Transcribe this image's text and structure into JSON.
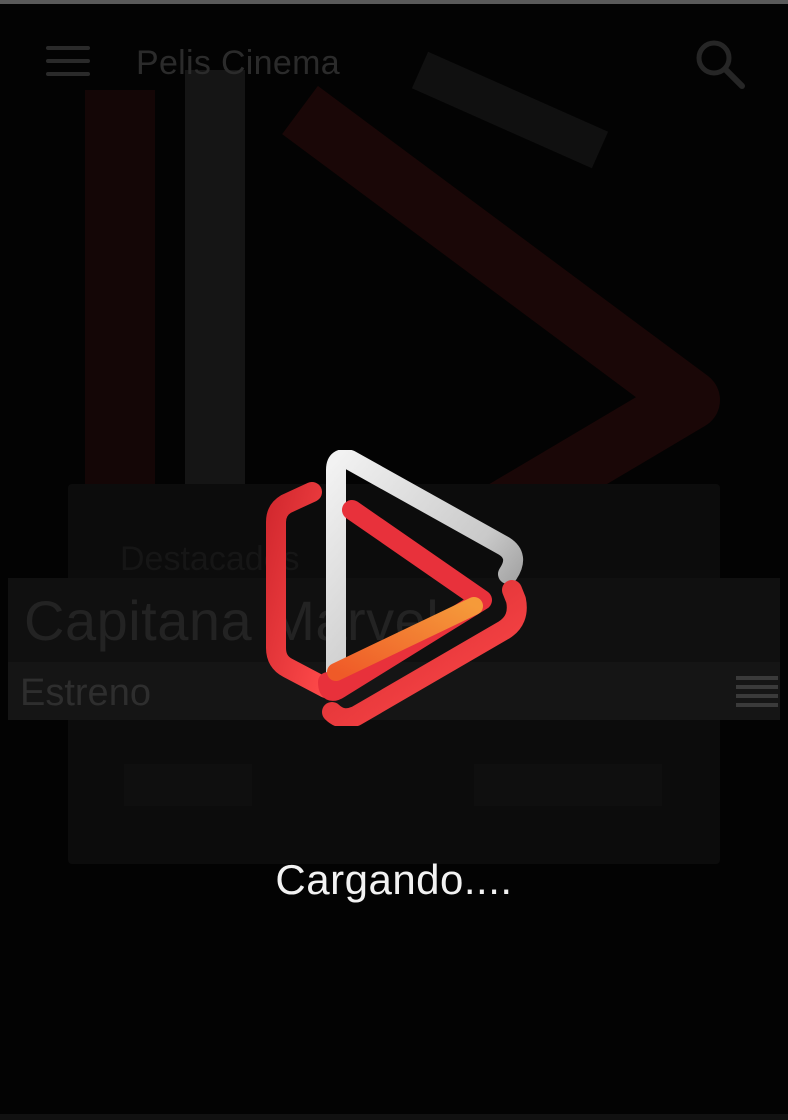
{
  "app": {
    "title": "Pelis Cinema"
  },
  "appbar": {
    "menu_icon": "hamburger-menu-icon",
    "search_icon": "search-icon"
  },
  "featured": {
    "ghost_label": "Destacados",
    "title": "Capitana Marvel",
    "badge": "Estreno",
    "list_icon": "list-icon",
    "button_left": "",
    "button_right": ""
  },
  "loading": {
    "text": "Cargando....",
    "logo_icon": "play-logo-icon"
  },
  "colors": {
    "background": "#000000",
    "logo_red": "#e8313b",
    "logo_orange": "#f07a2a",
    "logo_silver": "#d9d9d9",
    "text": "#f2f2f2"
  }
}
